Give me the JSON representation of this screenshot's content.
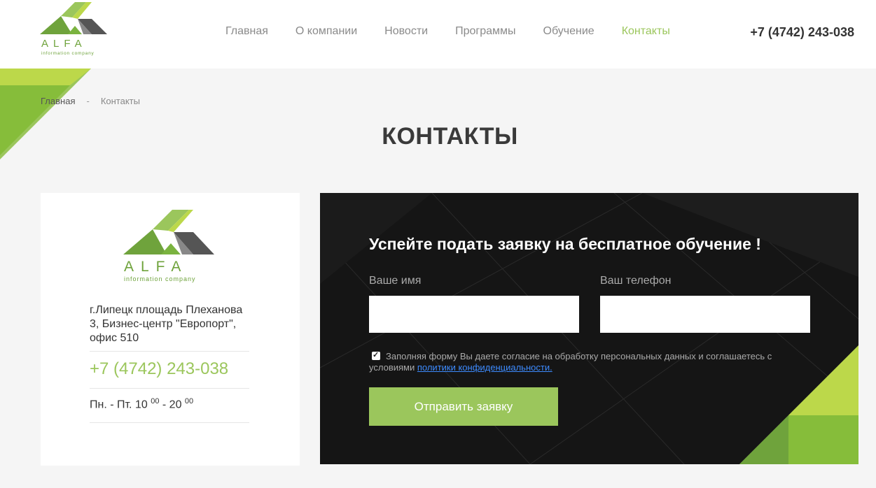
{
  "header": {
    "logo_word": "ALFA",
    "logo_tagline": "information company",
    "nav": [
      {
        "label": "Главная",
        "active": false
      },
      {
        "label": "О компании",
        "active": false
      },
      {
        "label": "Новости",
        "active": false
      },
      {
        "label": "Программы",
        "active": false
      },
      {
        "label": "Обучение",
        "active": false
      },
      {
        "label": "Контакты",
        "active": true
      }
    ],
    "phone": "+7 (4742) 243-038"
  },
  "breadcrumb": {
    "home": "Главная",
    "separator": "-",
    "current": "Контакты"
  },
  "page_title": "КОНТАКТЫ",
  "contact_card": {
    "logo_word": "ALFA",
    "logo_tagline": "information company",
    "address": "г.Липецк площадь Плеханова 3, Бизнес-центр \"Европорт\", офис 510",
    "phone": "+7 (4742) 243-038",
    "hours_prefix": "Пн. - Пт. 10",
    "hours_from_min": "00",
    "hours_dash": " - 20",
    "hours_to_min": "00"
  },
  "form": {
    "title": "Успейте подать заявку на бесплатное обучение !",
    "name_label": "Ваше имя",
    "name_value": "",
    "phone_label": "Ваш телефон",
    "phone_value": "",
    "consent_text": "Заполняя форму Вы даете согласие на обработку персональных данных и соглашаетесь с условиями",
    "consent_link": "политики конфиденциальности.",
    "consent_checked": true,
    "submit_label": "Отправить заявку"
  },
  "colors": {
    "accent": "#9bc65c",
    "dark": "#151515",
    "light_green": "#bcd84a",
    "logo_grey": "#555555"
  }
}
